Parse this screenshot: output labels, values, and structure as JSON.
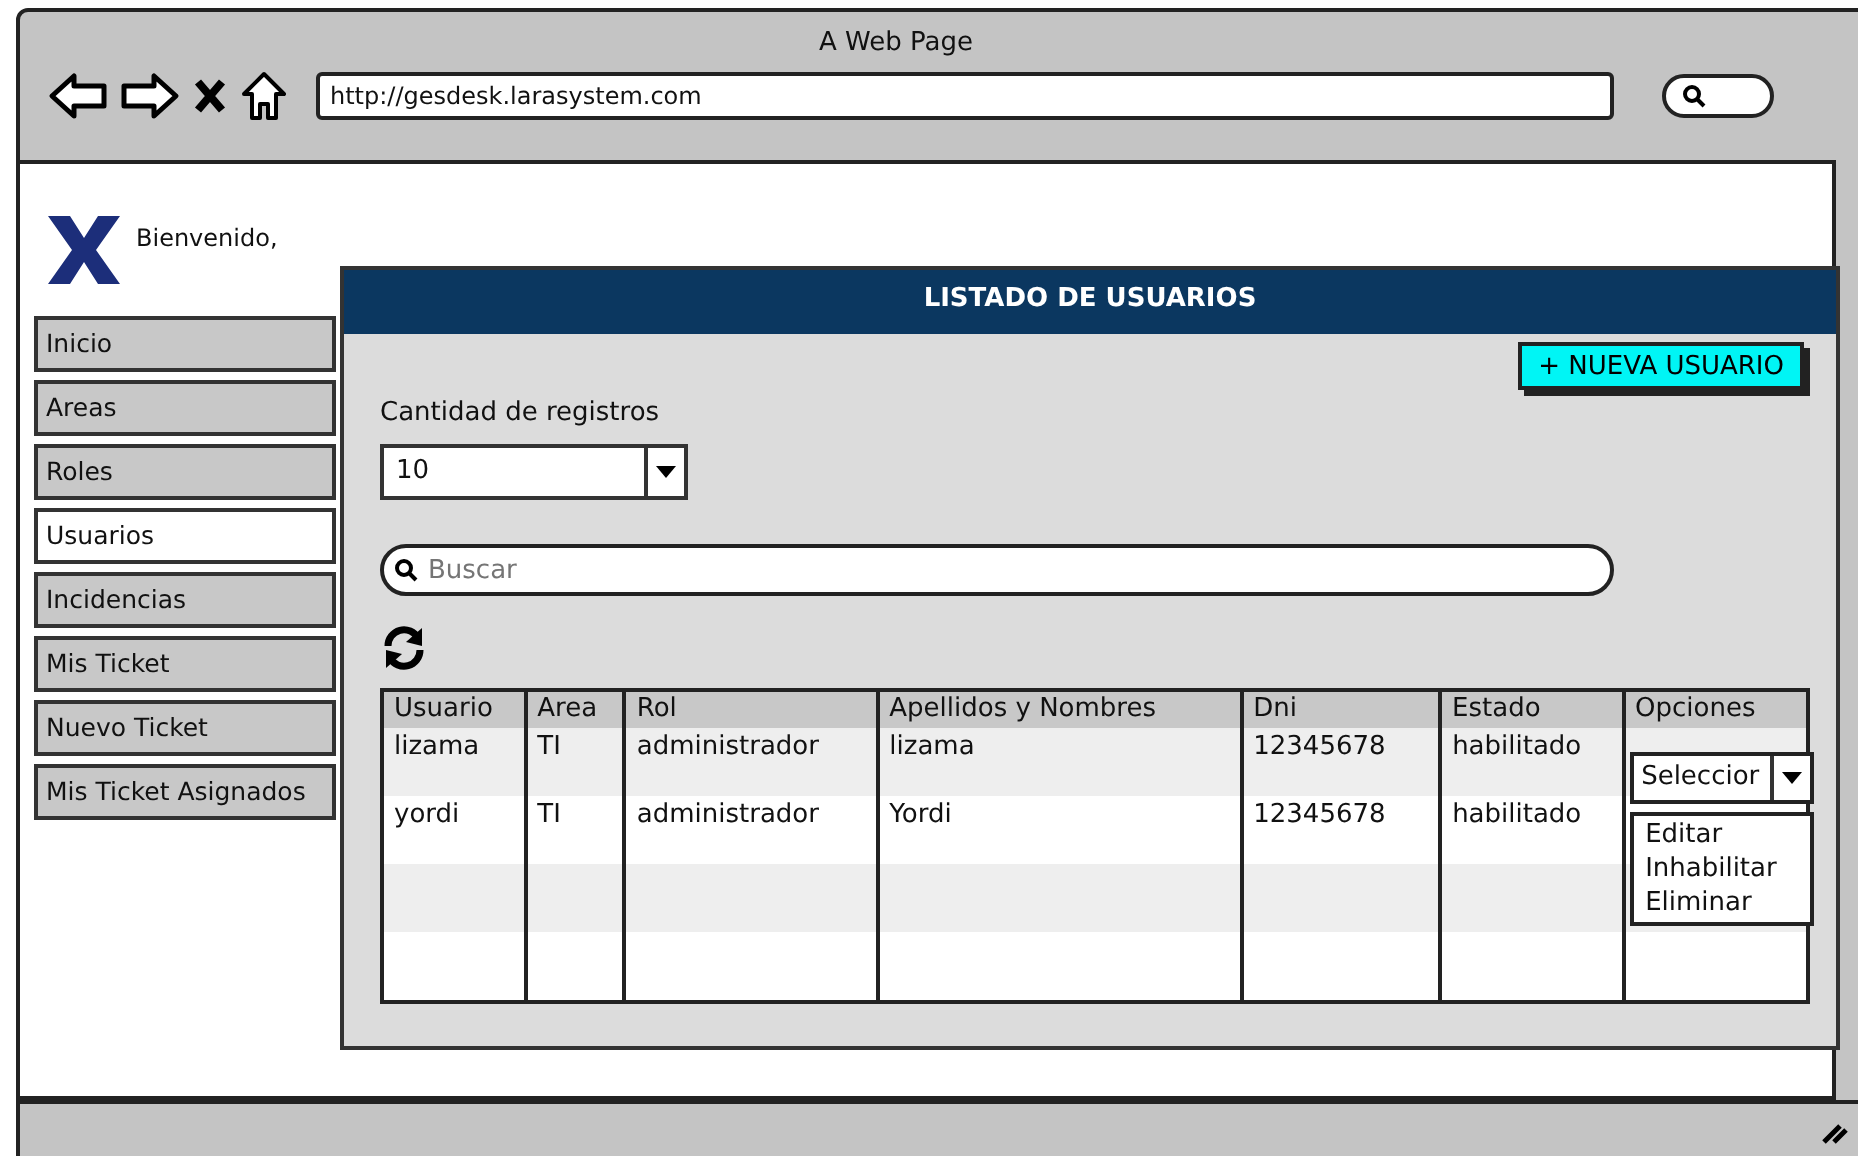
{
  "window": {
    "title": "A Web Page",
    "url": "http://gesdesk.larasystem.com"
  },
  "header": {
    "greeting": "Bienvenido,"
  },
  "sidebar": {
    "items": [
      {
        "label": "Inicio",
        "selected": false
      },
      {
        "label": "Areas",
        "selected": false
      },
      {
        "label": "Roles",
        "selected": false
      },
      {
        "label": "Usuarios",
        "selected": true
      },
      {
        "label": "Incidencias",
        "selected": false
      },
      {
        "label": "Mis Ticket",
        "selected": false
      },
      {
        "label": "Nuevo Ticket",
        "selected": false
      },
      {
        "label": "Mis Ticket Asignados",
        "selected": false
      }
    ]
  },
  "panel": {
    "title": "LISTADO DE USUARIOS",
    "new_button": "+ NUEVA USUARIO",
    "records_label": "Cantidad de registros",
    "records_select": {
      "value": "10"
    },
    "search": {
      "placeholder": "Buscar"
    },
    "table": {
      "columns": [
        "Usuario",
        "Area",
        "Rol",
        "Apellidos y Nombres",
        "Dni",
        "Estado",
        "Opciones"
      ],
      "rows": [
        {
          "cells": [
            "lizama",
            "TI",
            "administrador",
            "lizama",
            "12345678",
            "habilitado"
          ],
          "options_select": {
            "value": "Seleccior",
            "expanded": true,
            "items": [
              "Editar",
              "Inhabilitar",
              "Eliminar"
            ]
          }
        },
        {
          "cells": [
            "yordi",
            "TI",
            "administrador",
            "Yordi",
            "12345678",
            "habilitado"
          ]
        }
      ]
    }
  }
}
